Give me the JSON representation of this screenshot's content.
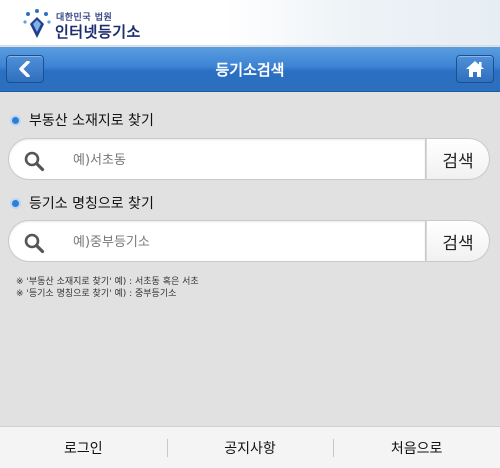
{
  "brand": {
    "small_label": "대한민국 법원",
    "name": "인터넷등기소",
    "emblem_icon": "court-emblem-icon"
  },
  "titlebar": {
    "title": "등기소검색",
    "back_icon": "chevron-left-icon",
    "home_icon": "home-icon",
    "color": "#3a80d0"
  },
  "sections": [
    {
      "label": "부동산 소재지로 찾기",
      "placeholder": "예)서초동",
      "value": "",
      "button_label": "검색"
    },
    {
      "label": "등기소 명칭으로 찾기",
      "placeholder": "예)중부등기소",
      "value": "",
      "button_label": "검색"
    }
  ],
  "notes": [
    "※ '부동산 소재지로 찾기' 예) : 서초동 혹은 서초",
    "※ '등기소 명칭으로 찾기' 예) : 중부등기소"
  ],
  "footer": {
    "items": [
      "로그인",
      "공지사항",
      "처음으로"
    ]
  }
}
